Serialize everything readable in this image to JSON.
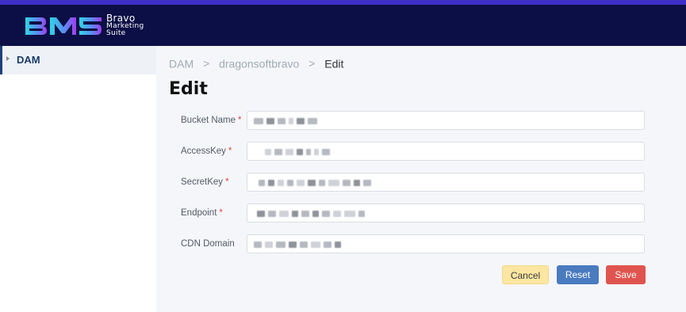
{
  "brand": {
    "logo_letters": "BMS",
    "line1": "Bravo",
    "line2": "Marketing",
    "line3": "Suite"
  },
  "sidebar": {
    "items": [
      {
        "label": "DAM",
        "active": true
      }
    ]
  },
  "breadcrumb": [
    "DAM",
    "dragonsoftbravo",
    "Edit"
  ],
  "page_title": "Edit",
  "form": {
    "fields": [
      {
        "label": "Bucket Name",
        "required": true,
        "value": "(redacted)"
      },
      {
        "label": "AccessKey",
        "required": true,
        "value": "(redacted)"
      },
      {
        "label": "SecretKey",
        "required": true,
        "value": "(redacted)"
      },
      {
        "label": "Endpoint",
        "required": true,
        "value": "(redacted)"
      },
      {
        "label": "CDN Domain",
        "required": false,
        "value": "(redacted)"
      }
    ],
    "required_mark": "*"
  },
  "actions": {
    "cancel": "Cancel",
    "reset": "Reset",
    "save": "Save"
  },
  "colors": {
    "header_bg": "#0c0f45",
    "accent_top": "#3d2fc8",
    "logo_gradient_start": "#2ed6e6",
    "logo_gradient_end": "#8a3cf0",
    "cancel_bg": "#fde6a2",
    "reset_bg": "#4a7bbf",
    "save_bg": "#e0544f",
    "required": "#e0453d"
  }
}
